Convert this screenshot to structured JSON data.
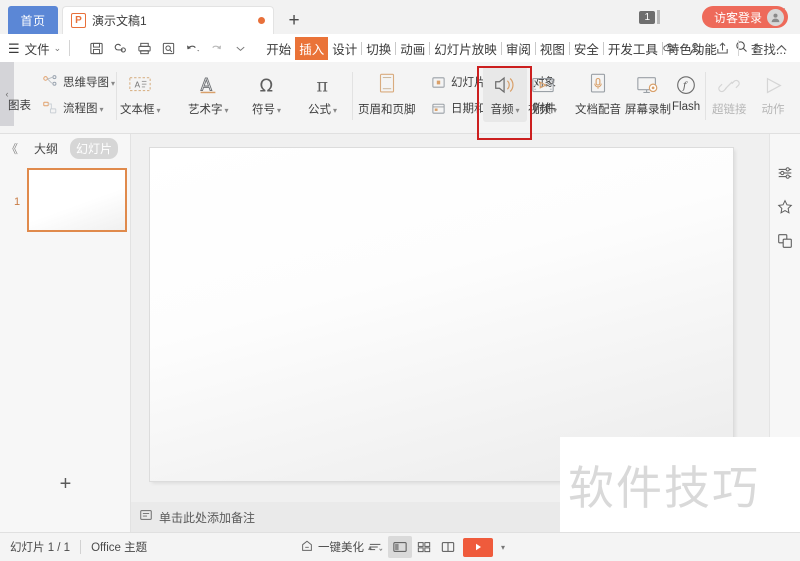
{
  "titlebar": {
    "home_tab": "首页",
    "doc_tab": {
      "icon_letter": "P",
      "label": "演示文稿1"
    },
    "new_tab_plus": "+",
    "page_badge": "1",
    "login": "访客登录",
    "win_min": "—",
    "win_max": "☐",
    "win_close": "✕"
  },
  "menubar": {
    "file_label": "文件",
    "file_caret": "⌄",
    "quick_tools": [
      "save-icon",
      "cloud-sync-icon",
      "print-icon",
      "print-preview-icon",
      "undo-icon",
      "redo-icon",
      "customize-caret-icon"
    ],
    "tabs": [
      {
        "label": "开始",
        "active": false
      },
      {
        "label": "插入",
        "active": true
      },
      {
        "label": "设计",
        "active": false
      },
      {
        "label": "切换",
        "active": false
      },
      {
        "label": "动画",
        "active": false
      },
      {
        "label": "幻灯片放映",
        "active": false
      },
      {
        "label": "审阅",
        "active": false
      },
      {
        "label": "视图",
        "active": false
      },
      {
        "label": "安全",
        "active": false
      },
      {
        "label": "开发工具",
        "active": false
      },
      {
        "label": "特色功能",
        "active": false
      }
    ],
    "search_label": "查找...",
    "right_tools": [
      "cloud-icon",
      "share-user-icon",
      "send-icon",
      "more-icon",
      "collapse-ribbon-icon"
    ]
  },
  "ribbon": {
    "collapse_arrow": "‹",
    "items": {
      "chart": "图表",
      "mindmap": "思维导图",
      "flowchart": "流程图",
      "textbox": "文本框",
      "wordart": "艺术字",
      "symbol": "符号",
      "formula": "公式",
      "header_footer": "页眉和页脚",
      "slide_number": "幻灯片编号",
      "date_time": "日期和时间",
      "object": "对象",
      "attachment": "附件",
      "audio": "音频",
      "video": "视频",
      "doc_dubbing": "文档配音",
      "screen_record": "屏幕录制",
      "flash": "Flash",
      "hyperlink": "超链接",
      "action": "动作"
    },
    "caret": "▾",
    "highlighted": "音频"
  },
  "leftpanel": {
    "collapse": "《",
    "tab_outline": "大纲",
    "tab_slides": "幻灯片",
    "slide_number": "1",
    "add_slide": "+"
  },
  "notes": {
    "placeholder": "单击此处添加备注"
  },
  "statusbar": {
    "slide_count": "幻灯片 1 / 1",
    "theme": "Office 主题",
    "beautify": "一键美化",
    "beautify_caret": "▴",
    "view_buttons": [
      "outline-view-icon",
      "normal-view-icon",
      "slide-sorter-icon",
      "reading-view-icon"
    ],
    "play_caret": "▾"
  },
  "rightbar": {
    "tools": [
      "properties-sliders-icon",
      "effects-star-icon",
      "shapes-layers-icon"
    ]
  },
  "watermark": {
    "text": "软件技巧"
  },
  "colors": {
    "accent_orange": "#ea7338",
    "home_tab_blue": "#5b87d6",
    "login_red": "#ee6a5a",
    "highlight_red": "#cc1f1f",
    "play_red": "#ef5b3c"
  }
}
